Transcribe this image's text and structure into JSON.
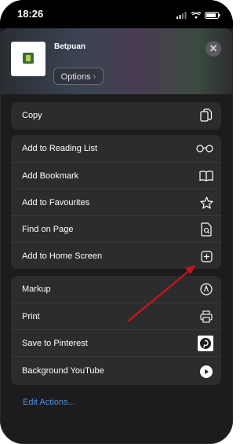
{
  "status": {
    "time": "18:26"
  },
  "header": {
    "site_name": "Betpuan",
    "options_label": "Options",
    "options_chevron": "›",
    "close_glyph": "✕"
  },
  "copy_group": {
    "items": [
      {
        "label": "Copy",
        "icon": "copy-icon"
      }
    ]
  },
  "main_group": {
    "items": [
      {
        "label": "Add to Reading List",
        "icon": "glasses-icon"
      },
      {
        "label": "Add Bookmark",
        "icon": "book-icon"
      },
      {
        "label": "Add to Favourites",
        "icon": "star-icon"
      },
      {
        "label": "Find on Page",
        "icon": "find-page-icon"
      },
      {
        "label": "Add to Home Screen",
        "icon": "plus-square-icon"
      }
    ]
  },
  "action_group": {
    "items": [
      {
        "label": "Markup",
        "icon": "markup-icon"
      },
      {
        "label": "Print",
        "icon": "printer-icon"
      },
      {
        "label": "Save to Pinterest",
        "icon": "pinterest-icon"
      },
      {
        "label": "Background YouTube",
        "icon": "play-icon"
      }
    ]
  },
  "edit_actions_label": "Edit Actions...",
  "annotation": {
    "arrow_color": "#c0161b"
  }
}
